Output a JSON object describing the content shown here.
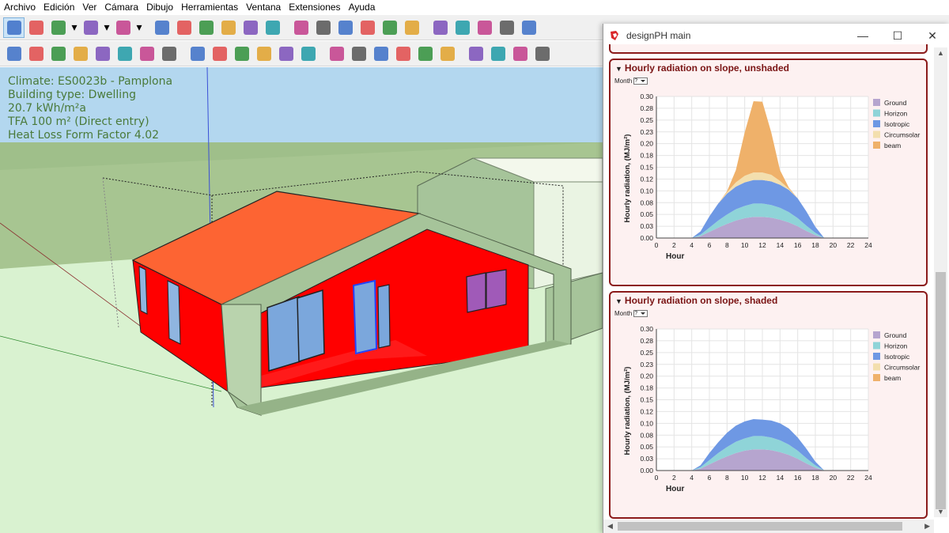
{
  "menu": [
    "Archivo",
    "Edición",
    "Ver",
    "Cámara",
    "Dibujo",
    "Herramientas",
    "Ventana",
    "Extensiones",
    "Ayuda"
  ],
  "toolbar1_icons": [
    "select-arrow-icon",
    "eraser-icon",
    "pencil-icon",
    "dropdown-arrow-icon",
    "arc-icon",
    "dropdown-arrow-icon",
    "rectangle-icon",
    "dropdown-arrow-icon",
    "push-pull-icon",
    "follow-me-icon",
    "move-icon",
    "rotate-icon",
    "scale-icon",
    "tape-measure-icon",
    "text-icon",
    "paint-bucket-icon",
    "orbit-icon",
    "pan-icon",
    "zoom-icon",
    "zoom-extents-icon",
    "components-icon",
    "warehouse-icon",
    "share-model-icon",
    "extension-warehouse-icon",
    "eraser-selected-icon"
  ],
  "toolbar2_icons": [
    "new-icon",
    "upload-icon",
    "save-icon",
    "save-dh-icon",
    "idf-export-icon",
    "idf-import-icon",
    "grid-icon",
    "add-component-icon",
    "tree-icon",
    "shading-icon",
    "calculator-icon",
    "light-icon",
    "person-icon",
    "window-icon",
    "recycle-icon",
    "plane-icon",
    "layout-icon",
    "search-icon",
    "filter-icon",
    "section-icon",
    "warning-icon",
    "box-icon",
    "help-icon",
    "package-icon"
  ],
  "viewport_info": {
    "line1": "Climate: ES0023b - Pamplona",
    "line2": "Building type: Dwelling",
    "line3": "20.7 kWh/m²a",
    "line4": "TFA  100 m² (Direct entry)",
    "line5": "Heat Loss Form Factor 4.02"
  },
  "window": {
    "title": "designPH main",
    "minimize": "—",
    "maximize": "☐",
    "close": "✕"
  },
  "panel1": {
    "title": "Hourly radiation on slope, unshaded",
    "month_label": "Month",
    "month_value": "?"
  },
  "panel2": {
    "title": "Hourly radiation on slope, shaded",
    "month_label": "Month",
    "month_value": "?"
  },
  "colors": {
    "ground": "#b6a5cf",
    "horizon": "#8fd4d8",
    "isotropic": "#6e98e4",
    "circumsolar": "#f3dfae",
    "beam": "#efb16a",
    "panel_border": "#8b1a1a",
    "panel_bg": "#fdf1f1",
    "roof": "#fd6433",
    "wall": "#ff0000",
    "ground_plane": "#d9f2d0",
    "sky": "#b3d7ef"
  },
  "chart_data": [
    {
      "type": "area",
      "stacked": true,
      "x": [
        0,
        1,
        2,
        3,
        4,
        5,
        6,
        7,
        8,
        9,
        10,
        11,
        12,
        13,
        14,
        15,
        16,
        17,
        18,
        19,
        20,
        21,
        22,
        23,
        24
      ],
      "series": [
        {
          "name": "Ground",
          "values": [
            0,
            0,
            0,
            0,
            0,
            0.004,
            0.013,
            0.022,
            0.03,
            0.037,
            0.042,
            0.045,
            0.045,
            0.043,
            0.039,
            0.033,
            0.025,
            0.015,
            0.006,
            0,
            0,
            0,
            0,
            0,
            0
          ]
        },
        {
          "name": "Horizon",
          "values": [
            0,
            0,
            0,
            0,
            0,
            0.003,
            0.009,
            0.015,
            0.02,
            0.024,
            0.026,
            0.028,
            0.028,
            0.027,
            0.025,
            0.022,
            0.017,
            0.011,
            0.005,
            0,
            0,
            0,
            0,
            0,
            0
          ]
        },
        {
          "name": "Isotropic",
          "values": [
            0,
            0,
            0,
            0,
            0,
            0.007,
            0.024,
            0.036,
            0.044,
            0.048,
            0.05,
            0.05,
            0.05,
            0.05,
            0.049,
            0.047,
            0.042,
            0.03,
            0.013,
            0,
            0,
            0,
            0,
            0,
            0
          ]
        },
        {
          "name": "Circumsolar",
          "values": [
            0,
            0,
            0,
            0,
            0,
            0,
            0,
            0,
            0.003,
            0.009,
            0.014,
            0.016,
            0.016,
            0.014,
            0.008,
            0.002,
            0,
            0,
            0,
            0,
            0,
            0,
            0,
            0,
            0
          ]
        },
        {
          "name": "beam",
          "values": [
            0,
            0,
            0,
            0,
            0,
            0,
            0,
            0,
            0.002,
            0.026,
            0.092,
            0.151,
            0.15,
            0.09,
            0.023,
            0.003,
            0,
            0,
            0,
            0,
            0,
            0,
            0,
            0,
            0
          ]
        }
      ],
      "title": "Hourly radiation on slope, unshaded",
      "xlabel": "Hour",
      "ylabel": "Hourly radiation, (MJ/m²)",
      "xlim": [
        0,
        24
      ],
      "ylim": [
        0,
        0.3
      ],
      "xticks": [
        0,
        2,
        4,
        6,
        8,
        10,
        12,
        14,
        16,
        18,
        20,
        22,
        24
      ],
      "yticks": [
        "0.00",
        "0.03",
        "0.05",
        "0.08",
        "0.10",
        "0.12",
        "0.15",
        "0.18",
        "0.20",
        "0.23",
        "0.25",
        "0.28",
        "0.30"
      ],
      "grid": true,
      "legend": "right"
    },
    {
      "type": "area",
      "stacked": true,
      "x": [
        0,
        1,
        2,
        3,
        4,
        5,
        6,
        7,
        8,
        9,
        10,
        11,
        12,
        13,
        14,
        15,
        16,
        17,
        18,
        19,
        20,
        21,
        22,
        23,
        24
      ],
      "series": [
        {
          "name": "Ground",
          "values": [
            0,
            0,
            0,
            0,
            0,
            0.004,
            0.013,
            0.022,
            0.03,
            0.037,
            0.042,
            0.045,
            0.045,
            0.043,
            0.039,
            0.033,
            0.025,
            0.015,
            0.006,
            0,
            0,
            0,
            0,
            0,
            0
          ]
        },
        {
          "name": "Horizon",
          "values": [
            0,
            0,
            0,
            0,
            0,
            0.003,
            0.009,
            0.015,
            0.02,
            0.024,
            0.026,
            0.028,
            0.028,
            0.027,
            0.025,
            0.022,
            0.017,
            0.011,
            0.005,
            0,
            0,
            0,
            0,
            0,
            0
          ]
        },
        {
          "name": "Isotropic",
          "values": [
            0,
            0,
            0,
            0,
            0,
            0.004,
            0.015,
            0.023,
            0.03,
            0.034,
            0.036,
            0.036,
            0.035,
            0.036,
            0.036,
            0.034,
            0.028,
            0.02,
            0.008,
            0,
            0,
            0,
            0,
            0,
            0
          ]
        },
        {
          "name": "Circumsolar",
          "values": [
            0,
            0,
            0,
            0,
            0,
            0,
            0,
            0,
            0,
            0,
            0,
            0,
            0,
            0,
            0,
            0,
            0,
            0,
            0,
            0,
            0,
            0,
            0,
            0,
            0
          ]
        },
        {
          "name": "beam",
          "values": [
            0,
            0,
            0,
            0,
            0,
            0,
            0,
            0,
            0,
            0,
            0,
            0,
            0,
            0,
            0,
            0,
            0,
            0,
            0,
            0,
            0,
            0,
            0,
            0,
            0
          ]
        }
      ],
      "title": "Hourly radiation on slope, shaded",
      "xlabel": "Hour",
      "ylabel": "Hourly radiation, (MJ/m²)",
      "xlim": [
        0,
        24
      ],
      "ylim": [
        0,
        0.3
      ],
      "xticks": [
        0,
        2,
        4,
        6,
        8,
        10,
        12,
        14,
        16,
        18,
        20,
        22,
        24
      ],
      "yticks": [
        "0.00",
        "0.03",
        "0.05",
        "0.08",
        "0.10",
        "0.12",
        "0.15",
        "0.18",
        "0.20",
        "0.23",
        "0.25",
        "0.28",
        "0.30"
      ],
      "grid": true,
      "legend": "right"
    }
  ]
}
